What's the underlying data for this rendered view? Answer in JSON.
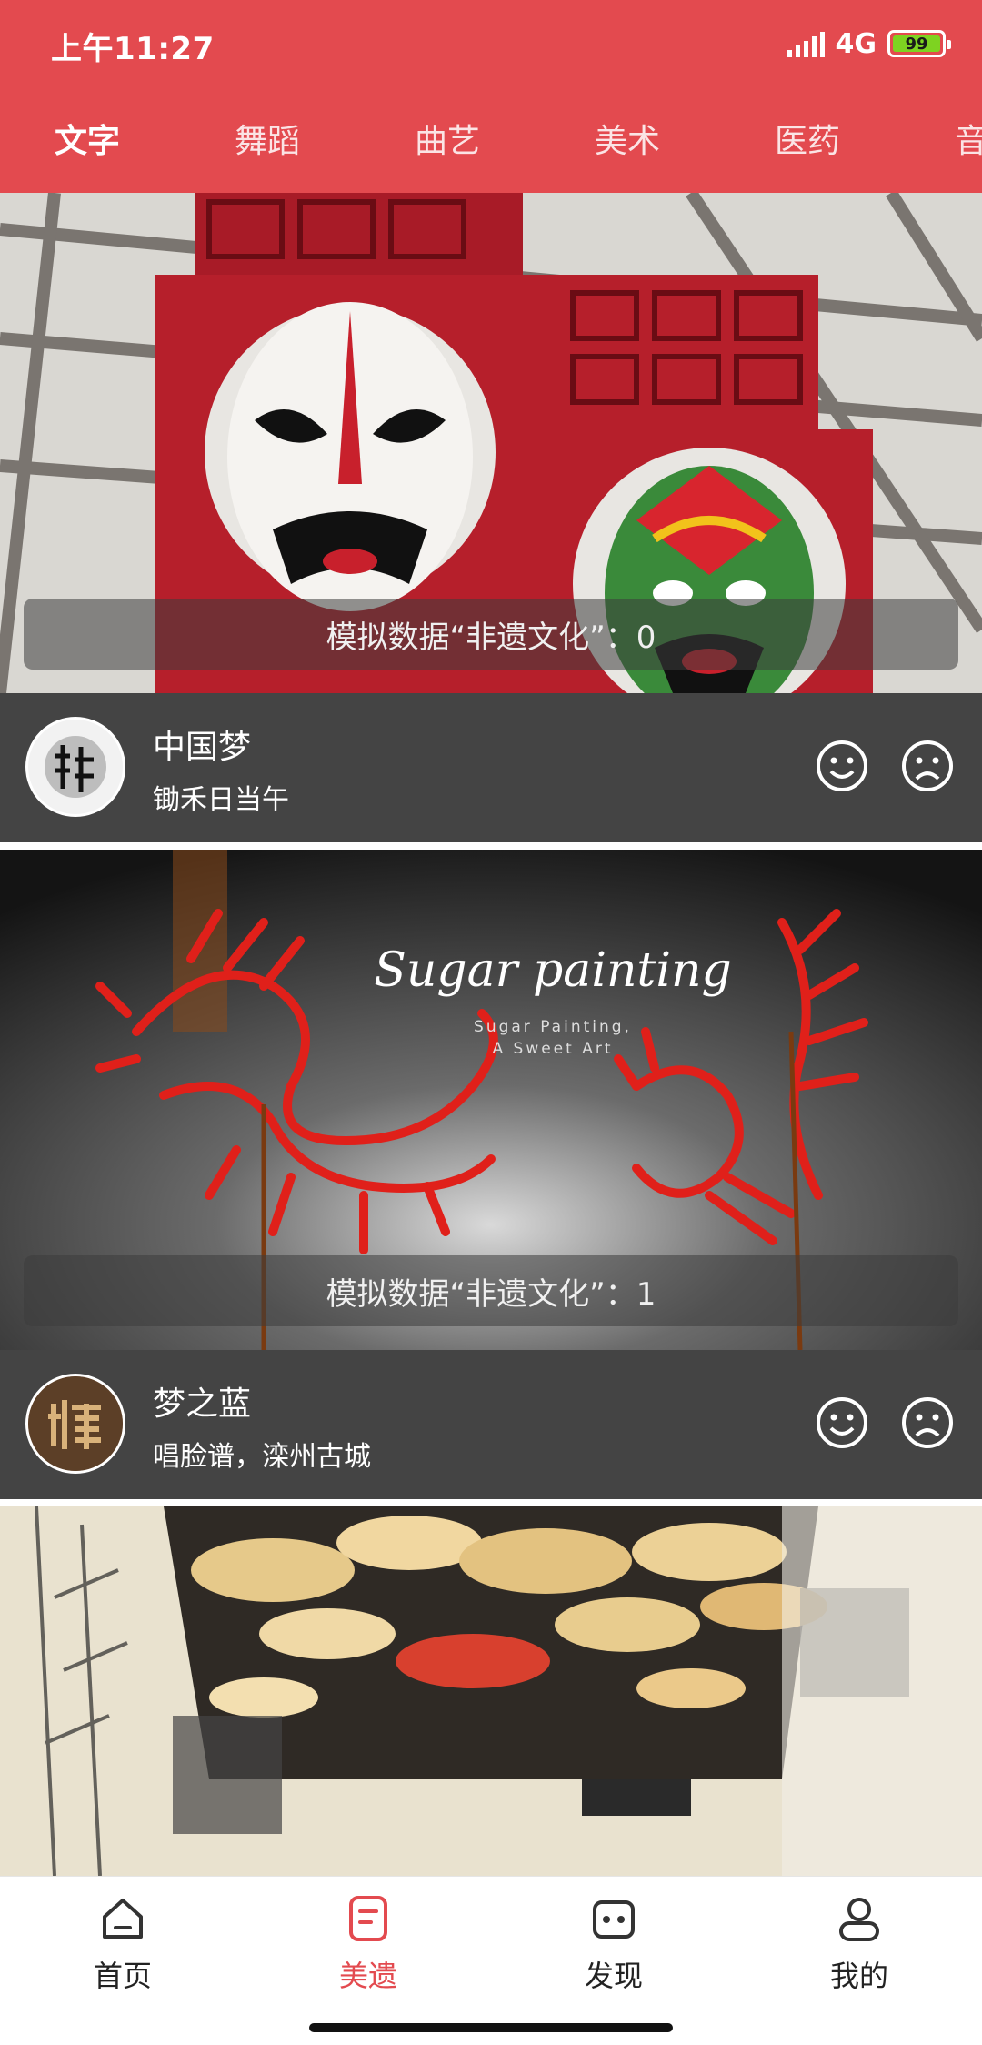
{
  "status_bar": {
    "time": "上午11:27",
    "network": "4G",
    "battery": "99"
  },
  "tabs": [
    {
      "label": "文字",
      "active": true
    },
    {
      "label": "舞蹈",
      "active": false
    },
    {
      "label": "曲艺",
      "active": false
    },
    {
      "label": "美术",
      "active": false
    },
    {
      "label": "医药",
      "active": false
    },
    {
      "label": "音",
      "active": false
    }
  ],
  "cards": [
    {
      "caption": "模拟数据“非遗文化”：0",
      "title": "中国梦",
      "subtitle": "锄禾日当午"
    },
    {
      "caption": "模拟数据“非遗文化”：1",
      "title": "梦之蓝",
      "subtitle": "唱脸谱，滦州古城",
      "image_text": {
        "heading": "Sugar painting",
        "sub1": "Sugar Painting,",
        "sub2": "A Sweet Art"
      }
    }
  ],
  "bottom_nav": [
    {
      "label": "首页",
      "icon": "home-icon",
      "active": false
    },
    {
      "label": "美遗",
      "icon": "document-icon",
      "active": true
    },
    {
      "label": "发现",
      "icon": "discover-icon",
      "active": false
    },
    {
      "label": "我的",
      "icon": "person-icon",
      "active": false
    }
  ],
  "colors": {
    "accent": "#e34a4f",
    "info_bar": "#444444"
  }
}
